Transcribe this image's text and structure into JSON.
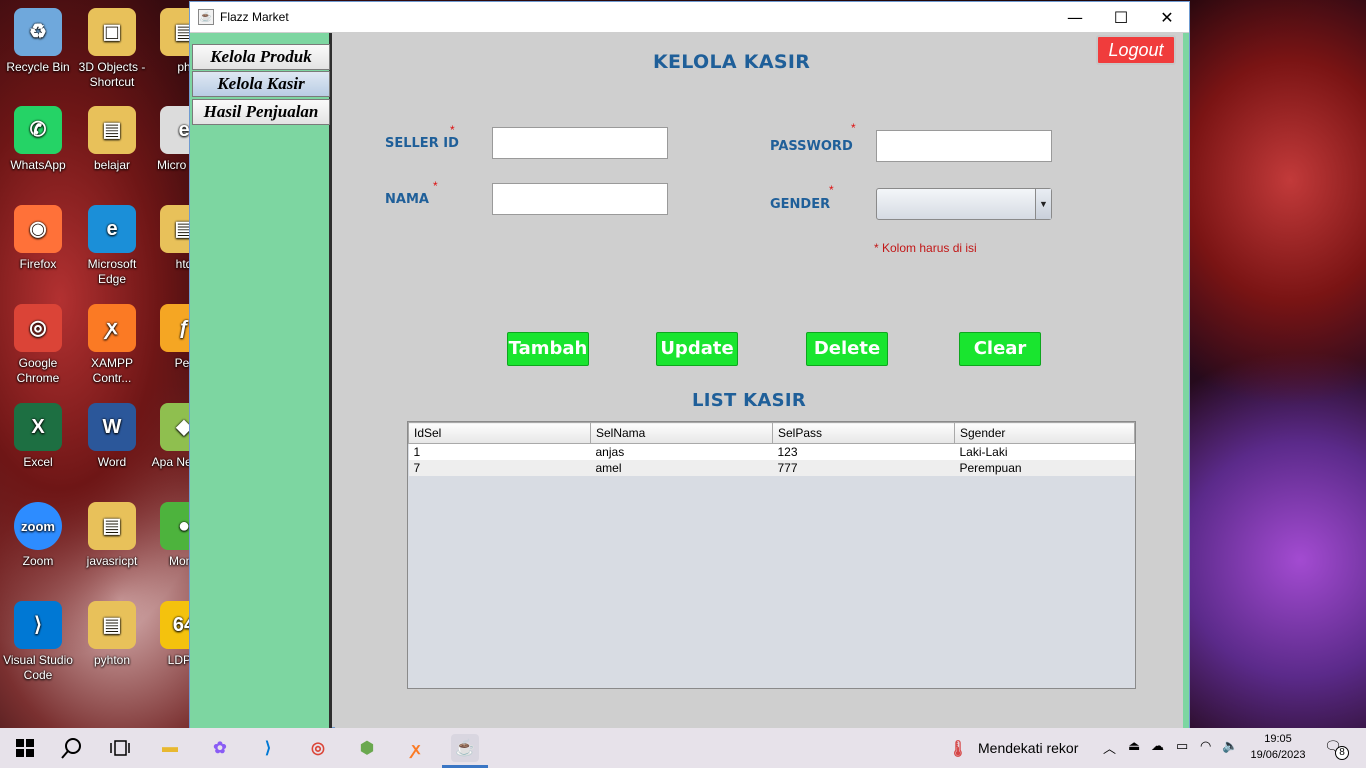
{
  "desktop": {
    "icons": [
      {
        "label": "Recycle Bin",
        "icon": "recycle-bin-icon",
        "color": "#6fa8dc",
        "glyph": "♻"
      },
      {
        "label": "3D Objects - Shortcut",
        "icon": "folder-3d-icon",
        "color": "#e8c15a",
        "glyph": "▣"
      },
      {
        "label": "ph",
        "icon": "folder-icon",
        "color": "#e8c15a",
        "glyph": "▤"
      },
      {
        "label": "WhatsApp",
        "icon": "whatsapp-icon",
        "color": "#25d366",
        "glyph": "✆"
      },
      {
        "label": "belajar",
        "icon": "folder-icon",
        "color": "#e8c15a",
        "glyph": "▤"
      },
      {
        "label": "Micro Edg",
        "icon": "edge-icon",
        "color": "#dcdcdc",
        "glyph": "e"
      },
      {
        "label": "Firefox",
        "icon": "firefox-icon",
        "color": "#ff7139",
        "glyph": "◉"
      },
      {
        "label": "Microsoft Edge",
        "icon": "edge-icon",
        "color": "#1b8fd8",
        "glyph": "e"
      },
      {
        "label": "htd",
        "icon": "folder-icon",
        "color": "#e8c15a",
        "glyph": "▤"
      },
      {
        "label": "Google Chrome",
        "icon": "chrome-icon",
        "color": "#db4437",
        "glyph": "◎"
      },
      {
        "label": "XAMPP Contr...",
        "icon": "xampp-icon",
        "color": "#fb7a24",
        "glyph": "ꭗ"
      },
      {
        "label": "Per",
        "icon": "app-icon",
        "color": "#f5a623",
        "glyph": "ƒ"
      },
      {
        "label": "Excel",
        "icon": "excel-icon",
        "color": "#1d6f42",
        "glyph": "X"
      },
      {
        "label": "Word",
        "icon": "word-icon",
        "color": "#2b579a",
        "glyph": "W"
      },
      {
        "label": "Apa NetBea",
        "icon": "netbeans-icon",
        "color": "#8fbf4f",
        "glyph": "◆"
      },
      {
        "label": "Zoom",
        "icon": "zoom-icon",
        "color": "#2d8cff",
        "glyph": "zoom"
      },
      {
        "label": "javasricpt",
        "icon": "folder-icon",
        "color": "#e8c15a",
        "glyph": "▤"
      },
      {
        "label": "Mong",
        "icon": "mongodb-icon",
        "color": "#4db33d",
        "glyph": "●"
      },
      {
        "label": "Visual Studio Code",
        "icon": "vscode-icon",
        "color": "#0078d4",
        "glyph": "⟩"
      },
      {
        "label": "pyhton",
        "icon": "folder-icon",
        "color": "#e8c15a",
        "glyph": "▤"
      },
      {
        "label": "LDPla",
        "icon": "ldplayer-icon",
        "color": "#f4c20d",
        "glyph": "64"
      }
    ]
  },
  "window": {
    "title": "Flazz Market",
    "controls": {
      "minimize": "—",
      "maximize": "☐",
      "close": "✕"
    }
  },
  "sidebar": {
    "items": [
      {
        "label": "Kelola Produk",
        "active": false
      },
      {
        "label": "Kelola Kasir",
        "active": true
      },
      {
        "label": "Hasil Penjualan",
        "active": false
      }
    ]
  },
  "main": {
    "heading": "KELOLA KASIR",
    "logout_label": "Logout",
    "form": {
      "seller_id_label": "SELLER ID",
      "seller_id_value": "",
      "nama_label": "NAMA",
      "nama_value": "",
      "password_label": "PASSWORD",
      "password_value": "",
      "gender_label": "GENDER",
      "gender_value": "",
      "required_mark": "*",
      "required_hint": "* Kolom harus di isi"
    },
    "buttons": {
      "tambah": "Tambah",
      "update": "Update",
      "delete": "Delete",
      "clear": "Clear"
    },
    "list_heading": "LIST KASIR",
    "table": {
      "columns": [
        "IdSel",
        "SelNama",
        "SelPass",
        "Sgender"
      ],
      "rows": [
        [
          "1",
          "anjas",
          "123",
          "Laki-Laki"
        ],
        [
          "7",
          "amel",
          "777",
          "Perempuan"
        ]
      ]
    },
    "colors": {
      "heading": "#1f5f99",
      "sidebar": "#7dd6a1",
      "action_button": "#19e52f",
      "logout": "#f03c3c"
    }
  },
  "taskbar": {
    "apps": [
      {
        "icon": "start-icon"
      },
      {
        "icon": "search-icon"
      },
      {
        "icon": "task-view-icon"
      },
      {
        "icon": "file-explorer-icon"
      },
      {
        "icon": "copilot-icon"
      },
      {
        "icon": "vscode-icon"
      },
      {
        "icon": "chrome-icon"
      },
      {
        "icon": "app-cube-icon"
      },
      {
        "icon": "xampp-icon"
      },
      {
        "icon": "java-icon",
        "active": true
      }
    ],
    "weather_text": "Mendekati rekor",
    "time": "19:05",
    "date": "19/06/2023",
    "notification_count": "8"
  }
}
